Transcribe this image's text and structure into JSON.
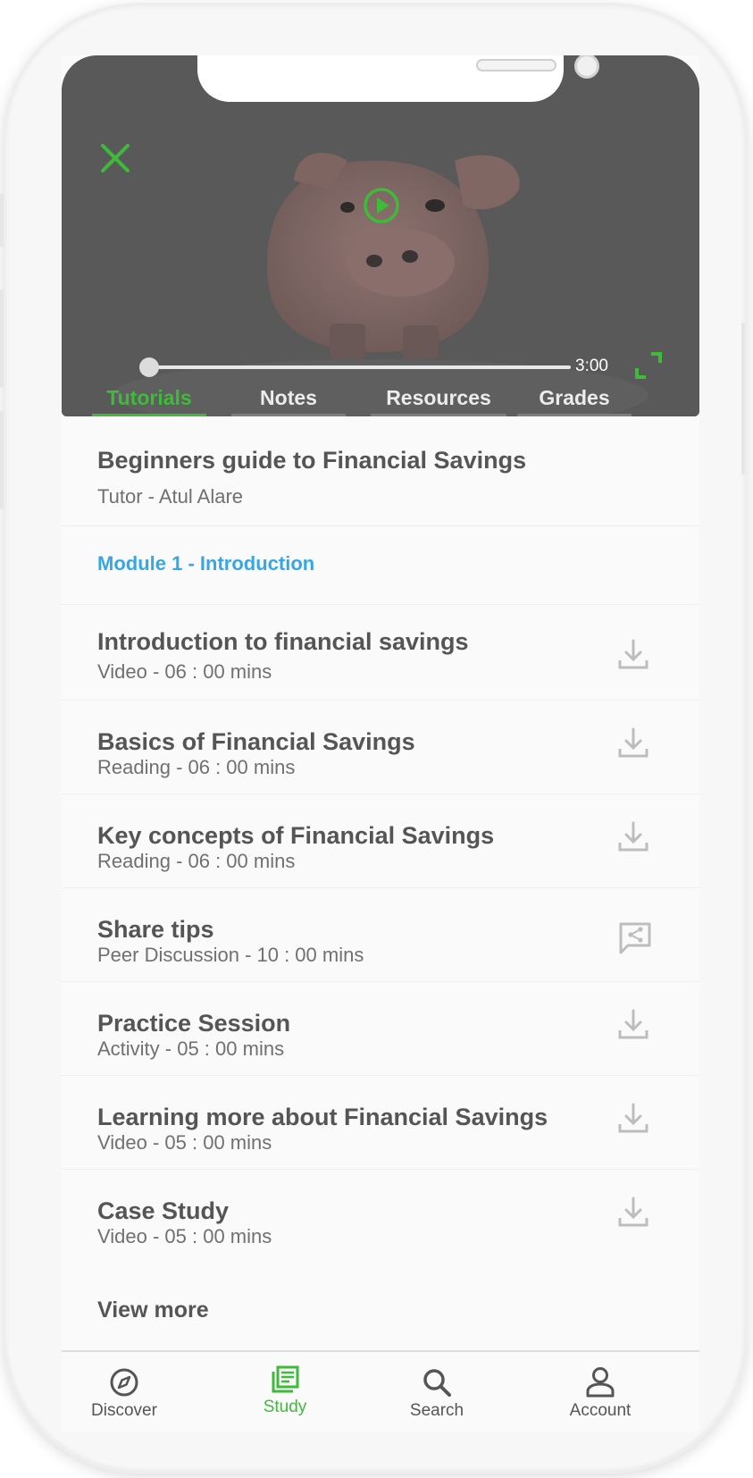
{
  "video": {
    "duration": "3:00",
    "progress": 0,
    "close_icon": "close-icon",
    "play_icon": "play-icon",
    "fullscreen_icon": "fullscreen-icon"
  },
  "tabs": [
    {
      "label": "Tutorials",
      "active": true
    },
    {
      "label": "Notes",
      "active": false
    },
    {
      "label": "Resources",
      "active": false
    },
    {
      "label": "Grades",
      "active": false
    }
  ],
  "course": {
    "title": "Beginners guide to Financial Savings",
    "tutor": "Tutor - Atul Alare"
  },
  "module": {
    "title": "Module 1 - Introduction"
  },
  "items": [
    {
      "title": "Introduction to financial savings",
      "sub": "Video - 06 : 00 mins",
      "icon": "download-icon"
    },
    {
      "title": "Basics of Financial Savings",
      "sub": "Reading - 06 : 00 mins",
      "icon": "download-icon"
    },
    {
      "title": "Key concepts of Financial Savings",
      "sub": "Reading - 06 : 00 mins",
      "icon": "download-icon"
    },
    {
      "title": "Share tips",
      "sub": "Peer Discussion - 10 : 00 mins",
      "icon": "share-discussion-icon"
    },
    {
      "title": "Practice Session",
      "sub": "Activity - 05 : 00 mins",
      "icon": "download-icon"
    },
    {
      "title": "Learning more about Financial Savings",
      "sub": "Video - 05 : 00 mins",
      "icon": "download-icon"
    },
    {
      "title": "Case Study",
      "sub": "Video - 05 : 00 mins",
      "icon": "download-icon"
    }
  ],
  "view_more": "View more",
  "nav": [
    {
      "label": "Discover",
      "icon": "compass-icon",
      "active": false
    },
    {
      "label": "Study",
      "icon": "study-icon",
      "active": true
    },
    {
      "label": "Search",
      "icon": "search-icon",
      "active": false
    },
    {
      "label": "Account",
      "icon": "account-icon",
      "active": false
    }
  ],
  "colors": {
    "accent": "#3dbb39",
    "module": "#36a7e3",
    "text": "#555555"
  }
}
